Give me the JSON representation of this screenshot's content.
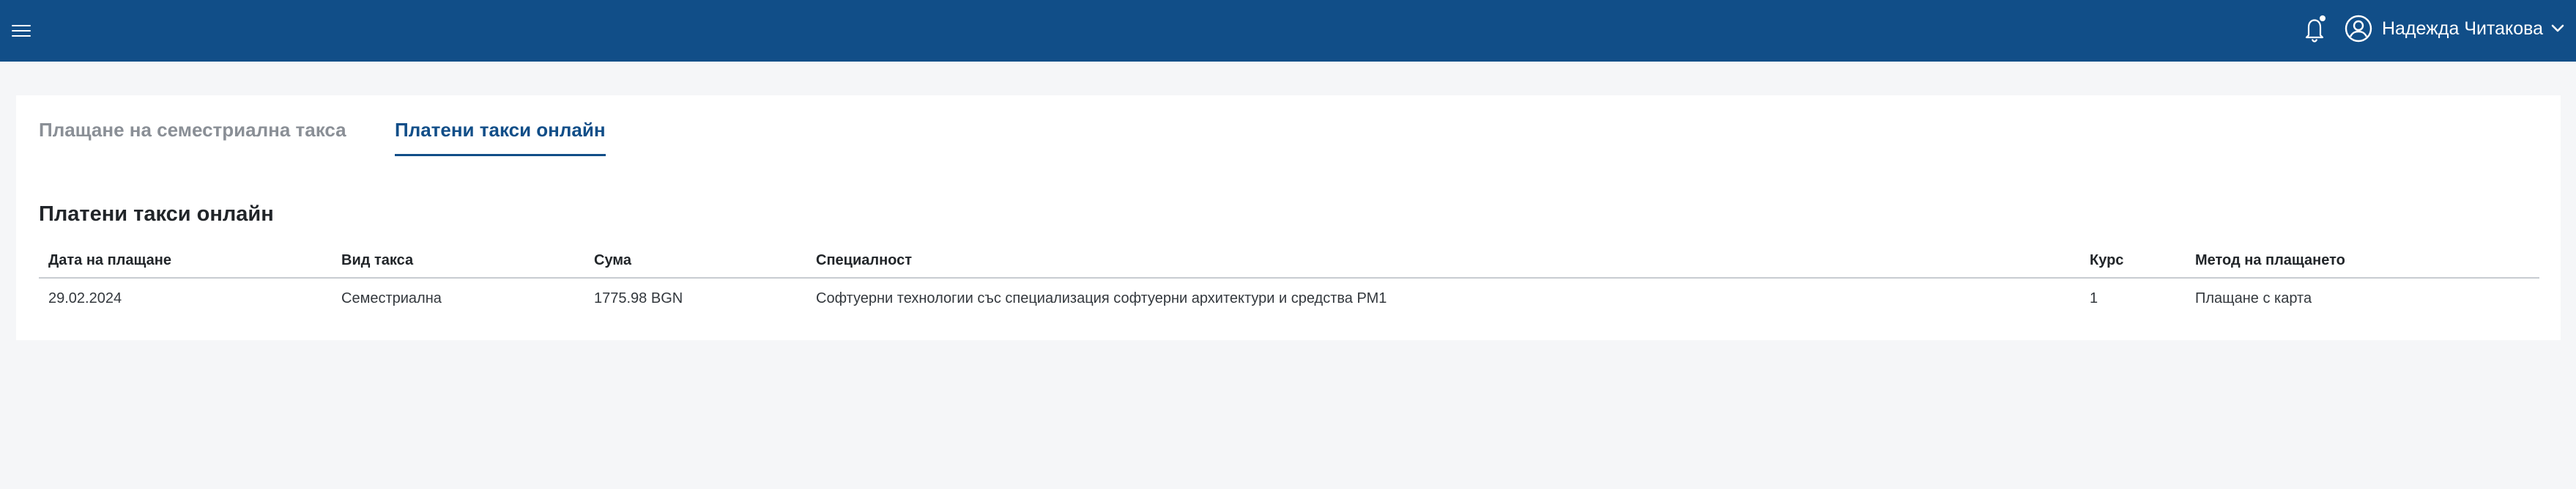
{
  "header": {
    "user_name": "Надежда Читакова",
    "icons": [
      "menu-icon",
      "bell-icon",
      "user-circle-icon",
      "chevron-down-icon"
    ],
    "background_color": "#114e88"
  },
  "tabs": [
    {
      "label": "Плащане на семестриална такса",
      "active": false
    },
    {
      "label": "Платени такси онлайн",
      "active": true
    }
  ],
  "section": {
    "title": "Платени такси онлайн"
  },
  "table": {
    "columns": [
      "Дата на плащане",
      "Вид такса",
      "Сума",
      "Специалност",
      "Курс",
      "Метод на плащането"
    ],
    "rows": [
      [
        "29.02.2024",
        "Семестриална",
        "1775.98 BGN",
        "Софтуерни технологии със специализация софтуерни архитектури и средства РМ1",
        "1",
        "Плащане с карта"
      ]
    ]
  },
  "colors": {
    "accent": "#114e88",
    "inactive_tab": "#8a8f96",
    "page_background": "#f5f6f8"
  }
}
